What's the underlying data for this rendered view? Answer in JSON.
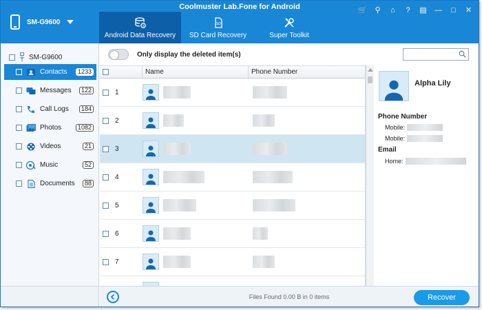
{
  "app": {
    "title": "Coolmuster Lab.Fone for Android",
    "device": "SM-G9600"
  },
  "tabs": [
    {
      "label": "Android Data Recovery",
      "active": true
    },
    {
      "label": "SD Card Recovery",
      "active": false
    },
    {
      "label": "Super Toolkit",
      "active": false
    }
  ],
  "window_controls": [
    "cart-icon",
    "key-icon",
    "home-icon",
    "help-icon",
    "feedback-icon",
    "minimize-icon",
    "maximize-icon",
    "close-icon"
  ],
  "sidebar": {
    "root": "SM-G9600",
    "categories": [
      {
        "label": "Contacts",
        "count": "1233",
        "icon": "contacts-icon",
        "active": true
      },
      {
        "label": "Messages",
        "count": "122",
        "icon": "messages-icon",
        "active": false
      },
      {
        "label": "Call Logs",
        "count": "184",
        "icon": "call-logs-icon",
        "active": false
      },
      {
        "label": "Photos",
        "count": "1082",
        "icon": "photos-icon",
        "active": false
      },
      {
        "label": "Videos",
        "count": "21",
        "icon": "videos-icon",
        "active": false
      },
      {
        "label": "Music",
        "count": "52",
        "icon": "music-icon",
        "active": false
      },
      {
        "label": "Documents",
        "count": "88",
        "icon": "documents-icon",
        "active": false
      }
    ]
  },
  "toolbar": {
    "toggle_label": "Only display the deleted item(s)",
    "search_placeholder": ""
  },
  "table": {
    "columns": [
      "Name",
      "Phone Number"
    ],
    "rows": [
      {
        "num": "1",
        "selected": false
      },
      {
        "num": "2",
        "selected": false
      },
      {
        "num": "3",
        "selected": true
      },
      {
        "num": "4",
        "selected": false
      },
      {
        "num": "5",
        "selected": false
      },
      {
        "num": "6",
        "selected": false
      },
      {
        "num": "7",
        "selected": false
      }
    ]
  },
  "detail": {
    "name": "Alpha Lily",
    "phone_section": "Phone Number",
    "mobile_label_1": "Mobile:",
    "mobile_label_2": "Mobile:",
    "email_section": "Email",
    "home_label": "Home:"
  },
  "footer": {
    "status": "Files Found 0.00 B in 0 items",
    "recover_label": "Recover"
  },
  "colors": {
    "accent": "#1a86d6",
    "tab_active": "#0d5fa8",
    "row_selected": "#cfe5f2",
    "recover_button": "#1a9be8"
  }
}
